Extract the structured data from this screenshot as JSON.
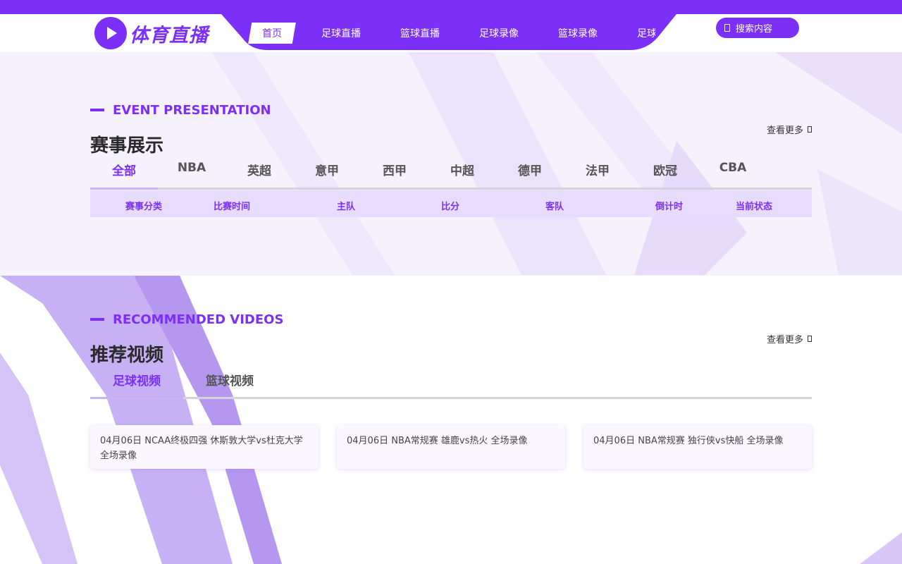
{
  "brand": {
    "name": "体育直播",
    "accent": "#7b2ff7"
  },
  "nav": {
    "items": [
      {
        "label": "首页",
        "active": true
      },
      {
        "label": "足球直播"
      },
      {
        "label": "篮球直播"
      },
      {
        "label": "足球录像"
      },
      {
        "label": "篮球录像"
      },
      {
        "label": "足球"
      }
    ]
  },
  "search": {
    "label": "搜索内容",
    "icon": "search-icon"
  },
  "events": {
    "en_title": "EVENT PRESENTATION",
    "cn_title": "赛事展示",
    "more": "查看更多",
    "tabs": [
      "全部",
      "NBA",
      "英超",
      "意甲",
      "西甲",
      "中超",
      "德甲",
      "法甲",
      "欧冠",
      "CBA"
    ],
    "active_tab": "全部",
    "columns": [
      "赛事分类",
      "比赛时间",
      "主队",
      "比分",
      "客队",
      "倒计时",
      "当前状态"
    ]
  },
  "videos": {
    "en_title": "RECOMMENDED VIDEOS",
    "cn_title": "推荐视频",
    "more": "查看更多",
    "tabs": [
      "足球视频",
      "篮球视频"
    ],
    "active_tab": "足球视频",
    "cards": [
      "04月06日 NCAA终极四强 休斯敦大学vs杜克大学 全场录像",
      "04月06日 NBA常规赛 雄鹿vs热火 全场录像",
      "04月06日 NBA常规赛 独行侠vs快船 全场录像"
    ]
  }
}
